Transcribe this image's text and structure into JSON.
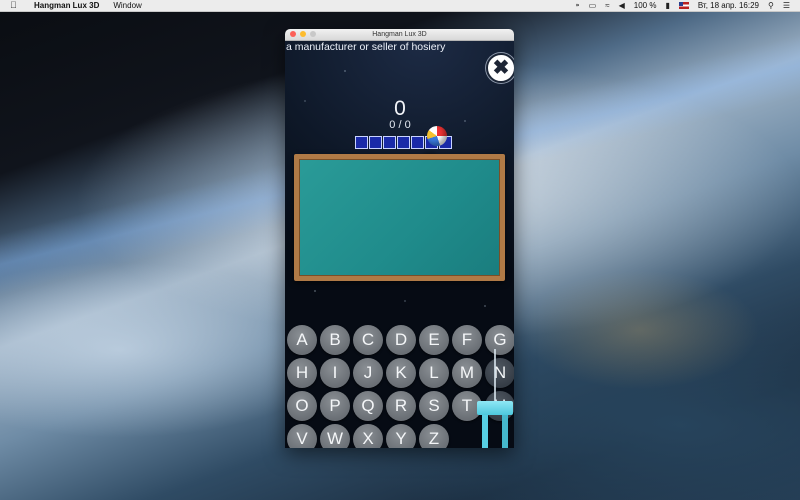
{
  "menubar": {
    "app_name": "Hangman Lux 3D",
    "menu_window": "Window",
    "battery": "100 %",
    "datetime": "Вт, 18 апр.  16:29"
  },
  "window": {
    "title": "Hangman Lux 3D"
  },
  "game": {
    "hint": "a manufacturer or seller of hosiery",
    "score": "0",
    "progress": "0 / 0",
    "slot_count": 7,
    "keys_row1": [
      "A",
      "B",
      "C",
      "D",
      "E",
      "F",
      "G"
    ],
    "keys_row2": [
      "H",
      "I",
      "J",
      "K",
      "L",
      "M",
      "N"
    ],
    "keys_row3": [
      "O",
      "P",
      "Q",
      "R",
      "S",
      "T",
      "U"
    ],
    "keys_row4": [
      "V",
      "W",
      "X",
      "Y",
      "Z"
    ]
  },
  "colors": {
    "board": "#1f8b8b",
    "frame": "#b07a46",
    "slot": "#1a2aa8",
    "key": "#6a6f75"
  }
}
